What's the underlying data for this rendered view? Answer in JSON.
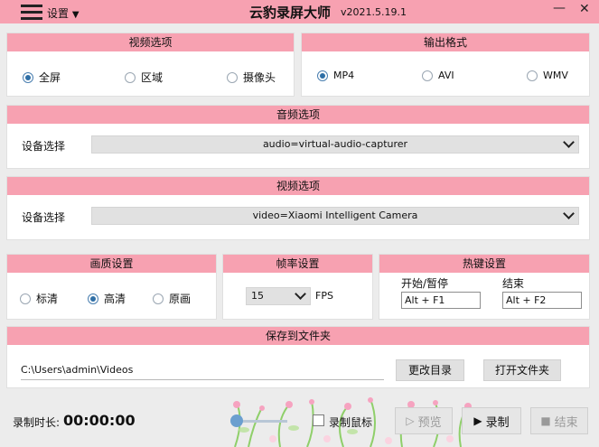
{
  "titlebar": {
    "menu_label": "设置",
    "title": "云豹录屏大师",
    "version": "v2021.5.19.1",
    "minimize": "—",
    "close": "✕"
  },
  "video_options": {
    "header": "视频选项",
    "radios": [
      "全屏",
      "区域",
      "摄像头"
    ],
    "selected": "全屏"
  },
  "output_format": {
    "header": "输出格式",
    "radios": [
      "MP4",
      "AVI",
      "WMV"
    ],
    "selected": "MP4"
  },
  "audio_options": {
    "header": "音频选项",
    "device_label": "设备选择",
    "device_value": "audio=virtual-audio-capturer"
  },
  "video_device": {
    "header": "视频选项",
    "device_label": "设备选择",
    "device_value": "video=Xiaomi Intelligent Camera"
  },
  "quality": {
    "header": "画质设置",
    "radios": [
      "标清",
      "高清",
      "原画"
    ],
    "selected": "高清"
  },
  "framerate": {
    "header": "帧率设置",
    "value": "15",
    "unit": "FPS"
  },
  "hotkeys": {
    "header": "热键设置",
    "start_label": "开始/暂停",
    "start_value": "Alt + F1",
    "end_label": "结束",
    "end_value": "Alt + F2"
  },
  "save_folder": {
    "header": "保存到文件夹",
    "path": "C:\\Users\\admin\\Videos",
    "change_button": "更改目录",
    "open_button": "打开文件夹"
  },
  "bottom": {
    "duration_label": "录制时长:",
    "duration_value": "00:00:00",
    "record_mouse": "录制鼠标",
    "preview_button": "预览",
    "record_button": "录制",
    "stop_button": "结束"
  }
}
